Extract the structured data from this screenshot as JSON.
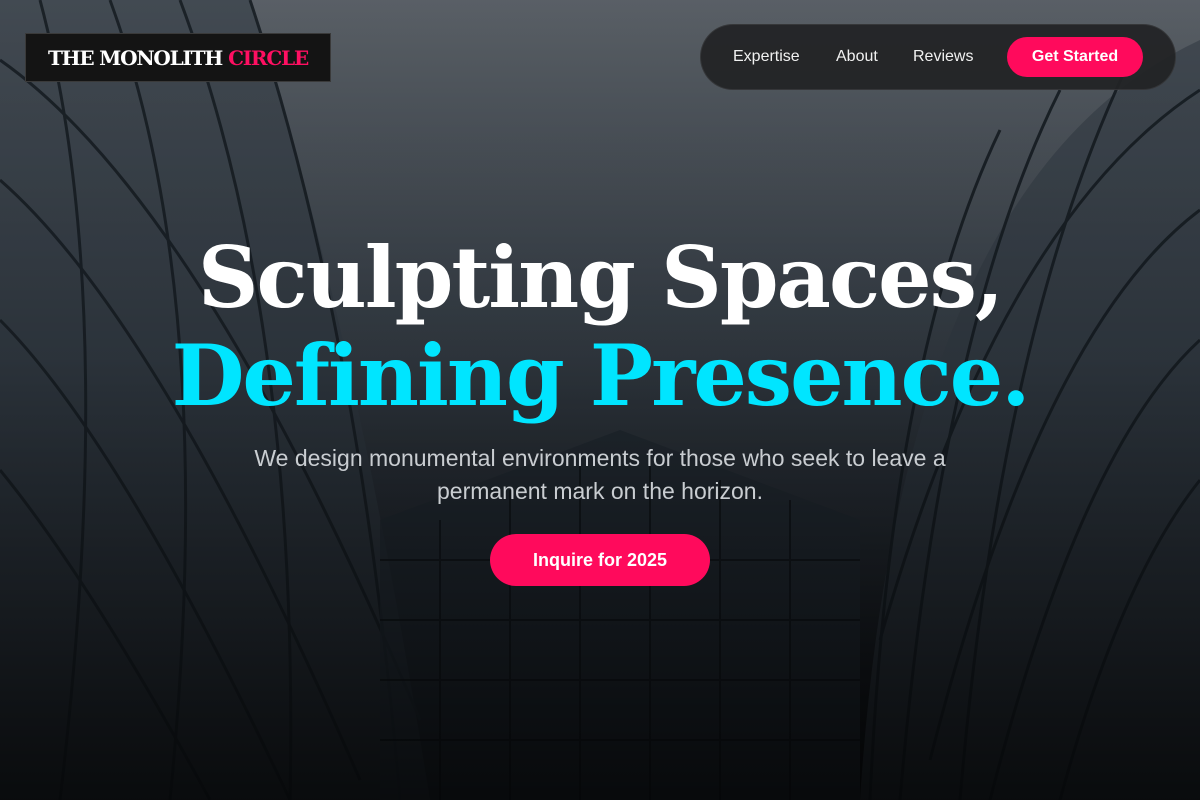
{
  "brand": {
    "name": "THE MONOLITH",
    "accent": "CIRCLE"
  },
  "nav": {
    "links": [
      "Expertise",
      "About",
      "Reviews"
    ],
    "cta": "Get Started"
  },
  "hero": {
    "headline_line1": "Sculpting Spaces,",
    "headline_line2": "Defining Presence.",
    "subtitle": "We design monumental environments for those who seek to leave a permanent mark on the horizon.",
    "cta": "Inquire for 2025",
    "background": "glass-skyscrapers-photo"
  },
  "colors": {
    "accent_pink": "#ff0a5c",
    "accent_cyan": "#00e5ff",
    "nav_bg": "#222325",
    "text_white": "#ffffff"
  }
}
